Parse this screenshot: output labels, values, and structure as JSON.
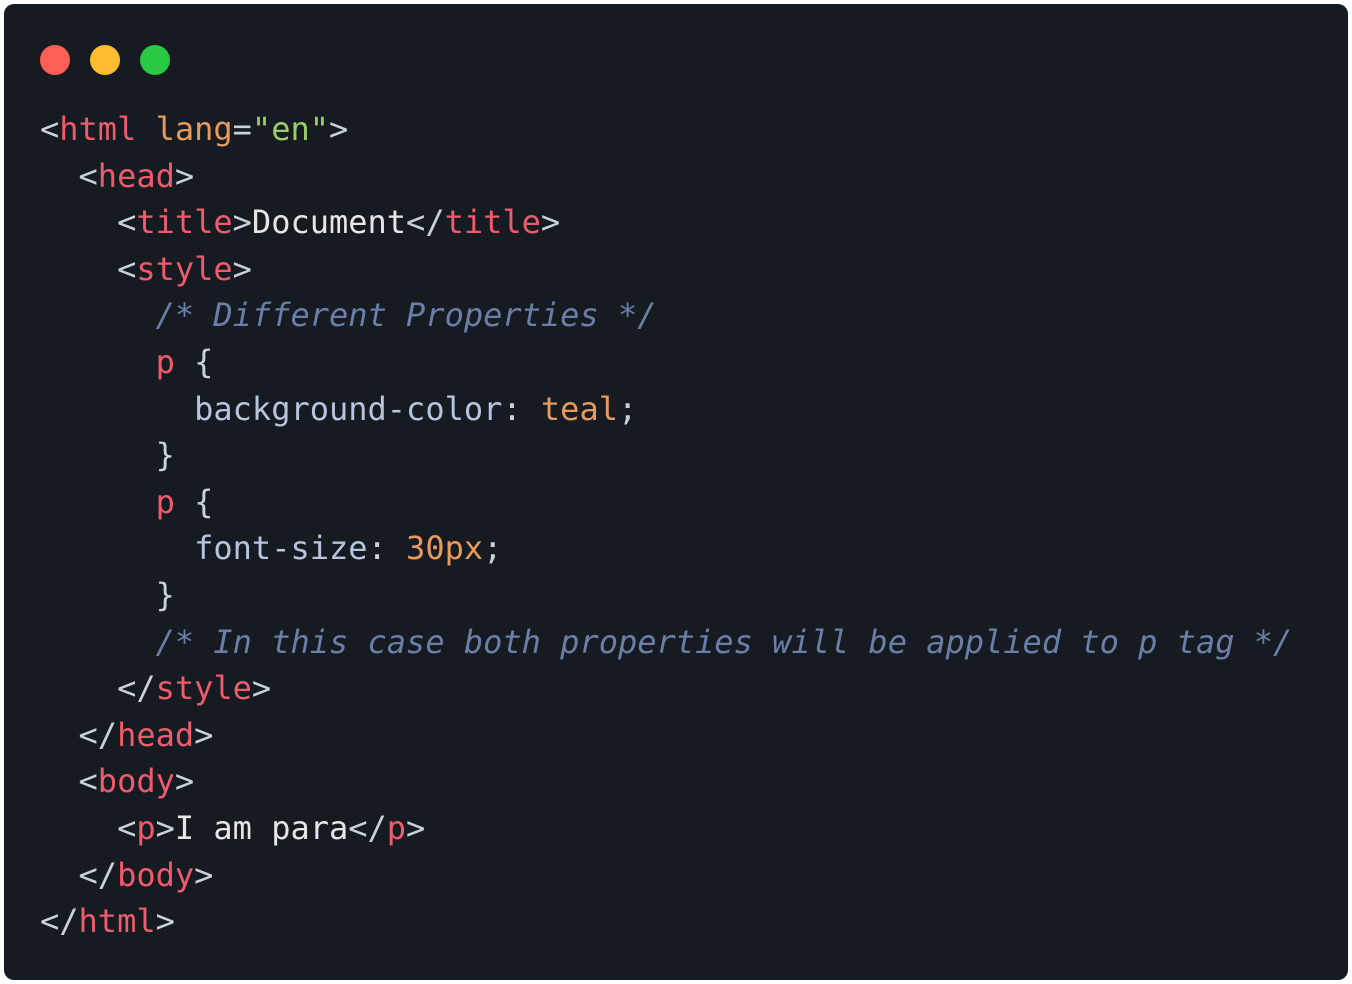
{
  "window": {
    "traffic_lights": [
      {
        "name": "close",
        "color": "#ff5f57"
      },
      {
        "name": "minimize",
        "color": "#febc2e"
      },
      {
        "name": "maximize",
        "color": "#28c840"
      }
    ]
  },
  "code": {
    "lines": [
      [
        {
          "t": "punct",
          "v": "<"
        },
        {
          "t": "tag",
          "v": "html"
        },
        {
          "t": "text",
          "v": " "
        },
        {
          "t": "attr",
          "v": "lang"
        },
        {
          "t": "punct",
          "v": "="
        },
        {
          "t": "string",
          "v": "\"en\""
        },
        {
          "t": "punct",
          "v": ">"
        }
      ],
      [
        {
          "t": "text",
          "v": "  "
        },
        {
          "t": "punct",
          "v": "<"
        },
        {
          "t": "tag",
          "v": "head"
        },
        {
          "t": "punct",
          "v": ">"
        }
      ],
      [
        {
          "t": "text",
          "v": "    "
        },
        {
          "t": "punct",
          "v": "<"
        },
        {
          "t": "tag",
          "v": "title"
        },
        {
          "t": "punct",
          "v": ">"
        },
        {
          "t": "text",
          "v": "Document"
        },
        {
          "t": "punct",
          "v": "</"
        },
        {
          "t": "tag",
          "v": "title"
        },
        {
          "t": "punct",
          "v": ">"
        }
      ],
      [
        {
          "t": "text",
          "v": "    "
        },
        {
          "t": "punct",
          "v": "<"
        },
        {
          "t": "tag",
          "v": "style"
        },
        {
          "t": "punct",
          "v": ">"
        }
      ],
      [
        {
          "t": "text",
          "v": "      "
        },
        {
          "t": "comment",
          "v": "/* Different Properties */"
        }
      ],
      [
        {
          "t": "text",
          "v": "      "
        },
        {
          "t": "select",
          "v": "p"
        },
        {
          "t": "punct",
          "v": " {"
        }
      ],
      [
        {
          "t": "text",
          "v": "        "
        },
        {
          "t": "prop",
          "v": "background-color"
        },
        {
          "t": "punct",
          "v": ": "
        },
        {
          "t": "value",
          "v": "teal"
        },
        {
          "t": "punct",
          "v": ";"
        }
      ],
      [
        {
          "t": "text",
          "v": "      "
        },
        {
          "t": "punct",
          "v": "}"
        }
      ],
      [
        {
          "t": "text",
          "v": "      "
        },
        {
          "t": "select",
          "v": "p"
        },
        {
          "t": "punct",
          "v": " {"
        }
      ],
      [
        {
          "t": "text",
          "v": "        "
        },
        {
          "t": "prop",
          "v": "font-size"
        },
        {
          "t": "punct",
          "v": ": "
        },
        {
          "t": "value",
          "v": "30px"
        },
        {
          "t": "punct",
          "v": ";"
        }
      ],
      [
        {
          "t": "text",
          "v": "      "
        },
        {
          "t": "punct",
          "v": "}"
        }
      ],
      [
        {
          "t": "text",
          "v": "      "
        },
        {
          "t": "comment",
          "v": "/* In this case both properties will be applied to p tag */"
        }
      ],
      [
        {
          "t": "text",
          "v": "    "
        },
        {
          "t": "punct",
          "v": "</"
        },
        {
          "t": "tag",
          "v": "style"
        },
        {
          "t": "punct",
          "v": ">"
        }
      ],
      [
        {
          "t": "text",
          "v": "  "
        },
        {
          "t": "punct",
          "v": "</"
        },
        {
          "t": "tag",
          "v": "head"
        },
        {
          "t": "punct",
          "v": ">"
        }
      ],
      [
        {
          "t": "text",
          "v": "  "
        },
        {
          "t": "punct",
          "v": "<"
        },
        {
          "t": "tag",
          "v": "body"
        },
        {
          "t": "punct",
          "v": ">"
        }
      ],
      [
        {
          "t": "text",
          "v": "    "
        },
        {
          "t": "punct",
          "v": "<"
        },
        {
          "t": "tag",
          "v": "p"
        },
        {
          "t": "punct",
          "v": ">"
        },
        {
          "t": "text",
          "v": "I am para"
        },
        {
          "t": "punct",
          "v": "</"
        },
        {
          "t": "tag",
          "v": "p"
        },
        {
          "t": "punct",
          "v": ">"
        }
      ],
      [
        {
          "t": "text",
          "v": "  "
        },
        {
          "t": "punct",
          "v": "</"
        },
        {
          "t": "tag",
          "v": "body"
        },
        {
          "t": "punct",
          "v": ">"
        }
      ],
      [
        {
          "t": "punct",
          "v": "</"
        },
        {
          "t": "tag",
          "v": "html"
        },
        {
          "t": "punct",
          "v": ">"
        }
      ]
    ]
  }
}
